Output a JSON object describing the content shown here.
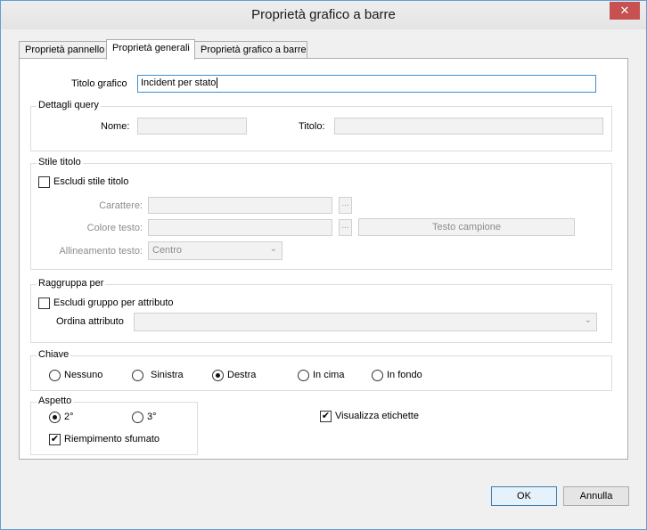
{
  "window": {
    "title": "Proprietà grafico a barre",
    "close": "✕"
  },
  "tabs": [
    {
      "label": "Proprietà pannello"
    },
    {
      "label": "Proprietà generali"
    },
    {
      "label": "Proprietà grafico a barre"
    }
  ],
  "general": {
    "chart_title_label": "Titolo grafico",
    "chart_title_value": "Incident per stato"
  },
  "query_details": {
    "group_title": "Dettagli query",
    "name_label": "Nome:",
    "title_label": "Titolo:"
  },
  "title_style": {
    "group_title": "Stile titolo",
    "exclude_label": "Escludi stile titolo",
    "font_label": "Carattere:",
    "text_color_label": "Colore testo:",
    "sample_text_label": "Testo campione",
    "text_align_label": "Allineamento testo:",
    "text_align_value": "Centro",
    "ellipsis": "..."
  },
  "group_by": {
    "group_title": "Raggruppa per",
    "exclude_label": "Escludi gruppo per attributo",
    "sort_label": "Ordina attributo"
  },
  "key": {
    "group_title": "Chiave",
    "options": [
      "Nessuno",
      "Sinistra",
      "Destra",
      "In cima",
      "In fondo"
    ],
    "selected": "Destra"
  },
  "appearance": {
    "group_title": "Aspetto",
    "options": [
      "2°",
      "3°"
    ],
    "selected": "2°",
    "gradient_fill_label": "Riempimento sfumato",
    "gradient_fill_checked": true,
    "show_labels_label": "Visualizza etichette",
    "show_labels_checked": true
  },
  "buttons": {
    "ok": "OK",
    "cancel": "Annulla"
  },
  "icons": {
    "check": "✔",
    "chevron": "⌄"
  }
}
